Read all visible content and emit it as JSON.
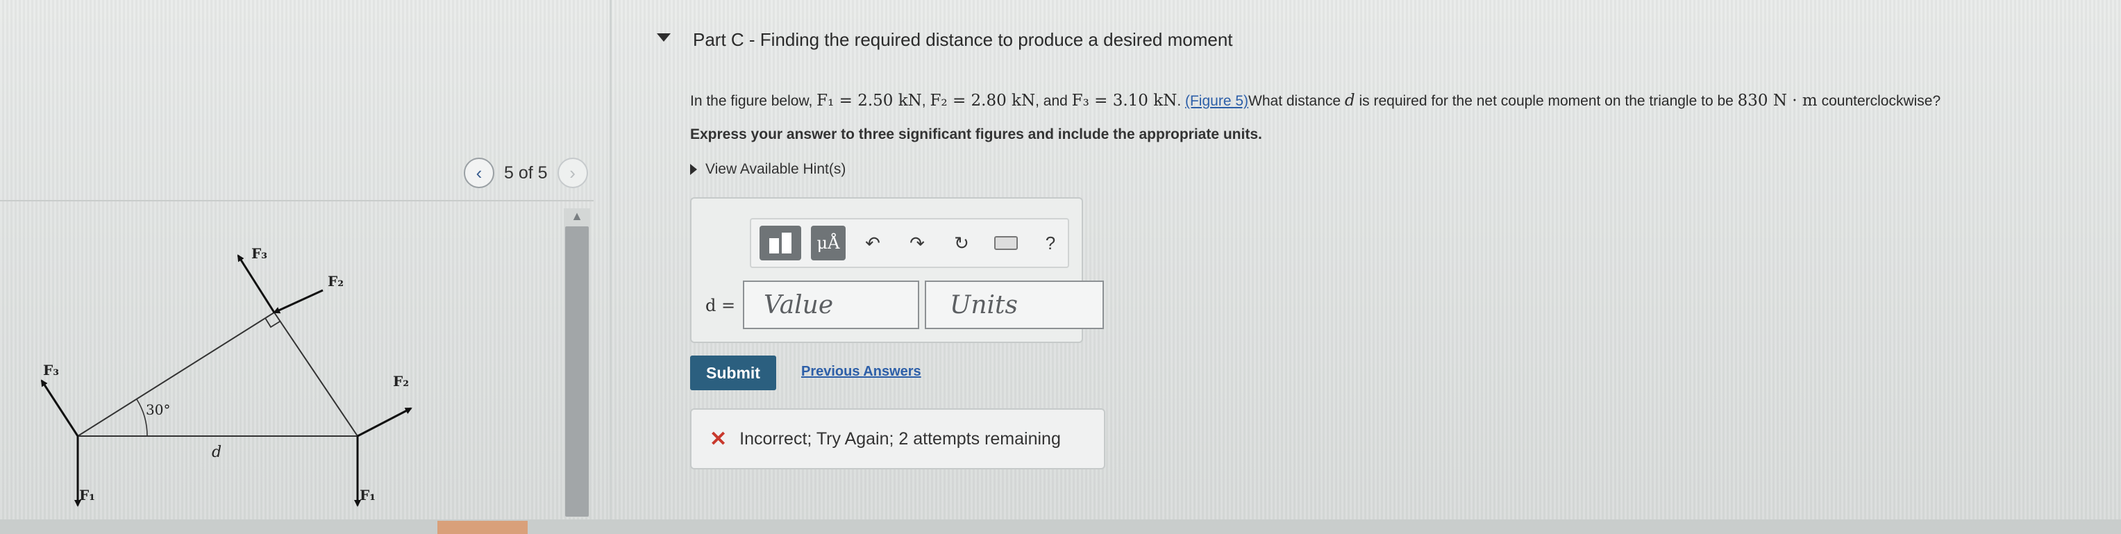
{
  "pager": {
    "prev_glyph": "‹",
    "next_glyph": "›",
    "text": "5 of 5"
  },
  "figure": {
    "labels": {
      "f3_left": "F₃",
      "f3_top": "F₃",
      "f2_top": "F₂",
      "f2_right": "F₂",
      "f1_left": "F₁",
      "f1_right": "F₁",
      "angle": "30°",
      "distance": "d"
    }
  },
  "part": {
    "title": "Part C - Finding the required distance to produce a desired moment"
  },
  "problem": {
    "intro": "In the figure below, ",
    "f1": "F₁ = 2.50 kN",
    "sep1": ", ",
    "f2": "F₂ = 2.80 kN",
    "sep2": ", and ",
    "f3": "F₃ = 3.10 kN",
    "sep3": ". ",
    "figure_link": "(Figure 5)",
    "question_a": "What distance ",
    "var_d": "d",
    "question_b": " is required for the net couple moment on the triangle to be ",
    "moment": "830 N · m",
    "question_c": " counterclockwise?"
  },
  "instruction": "Express your answer to three significant figures and include the appropriate units.",
  "hints_label": "View Available Hint(s)",
  "toolbar": {
    "units_icon": "μÅ",
    "undo_icon": "↶",
    "redo_icon": "↷",
    "reset_icon": "↻",
    "help_label": "?"
  },
  "answer": {
    "variable_label": "d =",
    "value_placeholder": "Value",
    "units_placeholder": "Units"
  },
  "submit_label": "Submit",
  "previous_answers_label": "Previous Answers",
  "feedback": {
    "icon": "✕",
    "text": "Incorrect; Try Again; 2 attempts remaining"
  },
  "colors": {
    "link": "#2d5fa8",
    "submit": "#2b5f7f",
    "error": "#c8382c"
  }
}
